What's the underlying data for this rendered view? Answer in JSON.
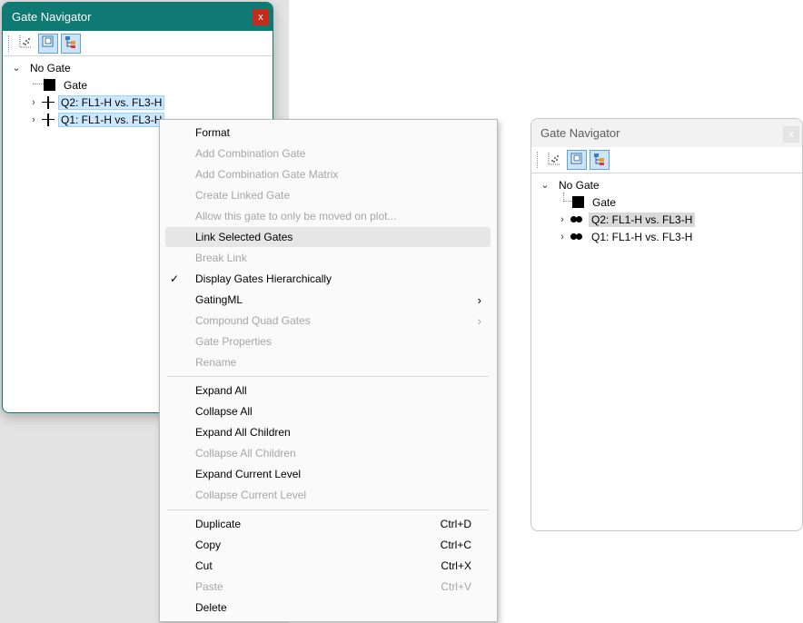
{
  "window_active": {
    "title": "Gate Navigator",
    "close_label": "x",
    "tree": {
      "root": "No Gate",
      "items": [
        {
          "label": "Gate"
        },
        {
          "label": "Q2: FL1-H vs. FL3-H"
        },
        {
          "label": "Q1: FL1-H vs. FL3-H"
        }
      ]
    }
  },
  "context_menu": {
    "items": [
      {
        "label": "Format"
      },
      {
        "label": "Add Combination Gate"
      },
      {
        "label": "Add Combination Gate Matrix"
      },
      {
        "label": "Create Linked Gate"
      },
      {
        "label": "Allow this gate to only be moved on plot..."
      },
      {
        "label": "Link Selected Gates"
      },
      {
        "label": "Break Link"
      },
      {
        "label": "Display Gates Hierarchically"
      },
      {
        "label": "GatingML"
      },
      {
        "label": "Compound Quad Gates"
      },
      {
        "label": "Gate Properties"
      },
      {
        "label": "Rename"
      },
      {
        "label": "Expand All"
      },
      {
        "label": "Collapse All"
      },
      {
        "label": "Expand All Children"
      },
      {
        "label": "Collapse All Children"
      },
      {
        "label": "Expand Current Level"
      },
      {
        "label": "Collapse Current Level"
      },
      {
        "label": "Duplicate",
        "shortcut": "Ctrl+D"
      },
      {
        "label": "Copy",
        "shortcut": "Ctrl+C"
      },
      {
        "label": "Cut",
        "shortcut": "Ctrl+X"
      },
      {
        "label": "Paste",
        "shortcut": "Ctrl+V"
      },
      {
        "label": "Delete"
      }
    ]
  },
  "window_inactive": {
    "title": "Gate Navigator",
    "close_label": "x",
    "tree": {
      "root": "No Gate",
      "items": [
        {
          "label": "Gate"
        },
        {
          "label": "Q2: FL1-H vs. FL3-H"
        },
        {
          "label": "Q1: FL1-H vs. FL3-H"
        }
      ]
    }
  },
  "colors": {
    "active_title_bar": "#0f7a74",
    "close_button": "#c42b1c",
    "selection": "#cce8ff",
    "disabled_text": "#a6a6a6"
  }
}
